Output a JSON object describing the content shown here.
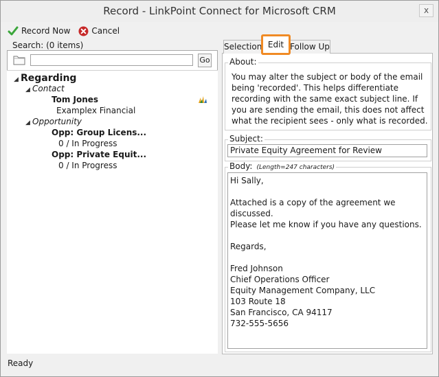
{
  "window": {
    "title": "Record - LinkPoint Connect for Microsoft CRM",
    "close_glyph": "x"
  },
  "toolbar": {
    "record_now": "Record Now",
    "cancel": "Cancel"
  },
  "search": {
    "label": "Search: (0 items)",
    "value": "",
    "go": "Go"
  },
  "tree": {
    "regarding": "Regarding",
    "contact_header": "Contact",
    "contact_name": "Tom Jones",
    "contact_company": "Examplex Financial",
    "opportunity_header": "Opportunity",
    "opp1_title": "Opp: Group Licens...",
    "opp1_status": "0 / In Progress",
    "opp2_title": "Opp: Private Equit...",
    "opp2_status": "0 / In Progress"
  },
  "tabs": [
    {
      "label": "Selection"
    },
    {
      "label": "Edit"
    },
    {
      "label": "Follow Up"
    }
  ],
  "about": {
    "legend": "About:",
    "text": "You may alter the subject or body of the email being 'recorded'.  This helps differentiate recording with the same exact subject line.  If you are sending the email, this does not affect what the recipient sees - only what is recorded."
  },
  "subject": {
    "legend": "Subject:",
    "value": "Private Equity Agreement for Review"
  },
  "body": {
    "legend": "Body:",
    "length_note": "(Length=247 characters)",
    "value": "Hi Sally,\n\nAttached is a copy of the agreement we discussed.\nPlease let me know if you have any questions.\n\nRegards,\n\nFred Johnson\nChief Operations Officer\nEquity Management Company, LLC\n103 Route 18\nSan Francisco, CA 94117\n732-555-5656"
  },
  "status": "Ready",
  "colors": {
    "accent_tab_highlight": "#f08a24",
    "cancel_red": "#c62828",
    "check_green": "#3aa63a"
  }
}
